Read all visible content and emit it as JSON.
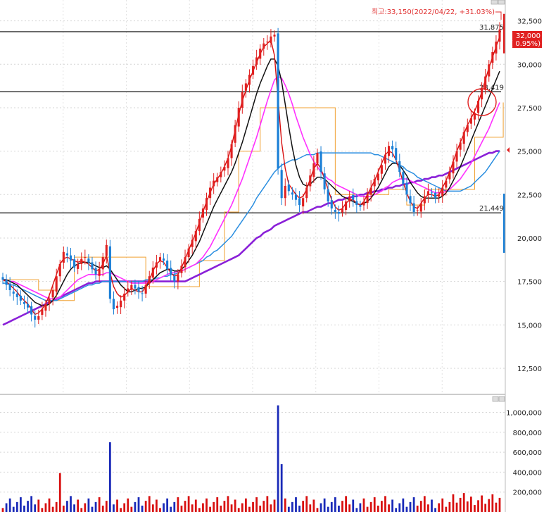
{
  "chart_data": [
    {
      "type": "candlestick",
      "high_label": "최고:33,150(2022/04/22, +31.03%)",
      "last_price_label": "32,000",
      "last_change_label": "( 0.95%)",
      "y_ticks": [
        "32,500",
        "30,000",
        "27,500",
        "25,000",
        "22,500",
        "20,000",
        "17,500",
        "15,000",
        "12,500"
      ],
      "y_tick_values": [
        32500,
        30000,
        27500,
        25000,
        22500,
        20000,
        17500,
        15000,
        12500
      ],
      "ylim": [
        11000,
        33700
      ],
      "grid": true,
      "horizontal_levels": [
        {
          "value": 31875,
          "label": "31,875"
        },
        {
          "value": 28419,
          "label": "28,419"
        },
        {
          "value": 21449,
          "label": "21,449"
        }
      ],
      "volume_profile": [
        {
          "price": 32500,
          "length": 0.1,
          "color": "#e02020"
        },
        {
          "price": 24500,
          "length": 0.15,
          "color": "#1a7fd6"
        }
      ],
      "colors": {
        "up": "#e02020",
        "down": "#1a7fd6",
        "ma5": "#d81010",
        "ma10": "#111111",
        "ma20": "#ff30ff",
        "ma60": "#2a8ee0",
        "ma120": "#8a20d8",
        "envelope": "#f0a030"
      },
      "close": [
        17600,
        17300,
        17000,
        16800,
        16600,
        16400,
        16200,
        16000,
        15600,
        15300,
        15500,
        15900,
        16200,
        16500,
        17000,
        17800,
        18500,
        19200,
        19000,
        18700,
        18300,
        18500,
        18800,
        18900,
        18600,
        18200,
        17900,
        18200,
        18900,
        19600,
        16500,
        15900,
        16100,
        16400,
        16800,
        17100,
        17300,
        17100,
        16900,
        16800,
        17300,
        17800,
        18300,
        18600,
        18900,
        18700,
        18200,
        17900,
        17500,
        17900,
        18400,
        18900,
        19400,
        19900,
        20400,
        21100,
        21700,
        22300,
        22900,
        23300,
        23500,
        23800,
        24100,
        24600,
        25400,
        26500,
        27500,
        28400,
        28900,
        29400,
        29900,
        30400,
        30900,
        31200,
        31300,
        31600,
        31700,
        24000,
        22300,
        23000,
        22700,
        22500,
        22200,
        21900,
        22300,
        22900,
        23600,
        24300,
        24900,
        23800,
        22800,
        22100,
        21700,
        21500,
        21400,
        21700,
        22100,
        22400,
        22200,
        21900,
        21800,
        22100,
        22500,
        22900,
        23400,
        23700,
        24200,
        24800,
        25300,
        25100,
        24500,
        23800,
        23100,
        22500,
        22000,
        21500,
        21600,
        22000,
        22400,
        22700,
        22600,
        22300,
        22500,
        22900,
        23300,
        23800,
        24400,
        25000,
        25500,
        26100,
        26500,
        26900,
        27200,
        27900,
        28600,
        29300,
        30000,
        30700,
        31300,
        32000
      ],
      "ma": {
        "ma5": [
          17600,
          17500,
          17300,
          17100,
          16900,
          16600,
          16400,
          16200,
          15900,
          15600,
          15700,
          15900,
          16200,
          16700,
          17300,
          17900,
          18500,
          18800,
          18900,
          18800,
          18700,
          18600,
          18700,
          18600,
          18500,
          18300,
          18100,
          18200,
          18500,
          19000,
          18000,
          17200,
          16800,
          16600,
          16700,
          16900,
          17100,
          17000,
          16900,
          16900,
          17200,
          17600,
          18100,
          18500,
          18700,
          18600,
          18300,
          18000,
          17800,
          17900,
          18300,
          18800,
          19300,
          19800,
          20300,
          20900,
          21500,
          22100,
          22600,
          23100,
          23400,
          23700,
          24100,
          24600,
          25300,
          26200,
          27100,
          27900,
          28500,
          29100,
          29600,
          30100,
          30600,
          31000,
          31200,
          31400,
          30500,
          28000,
          25500,
          24000,
          23100,
          22800,
          22500,
          22300,
          22400,
          22800,
          23400,
          24000,
          24300,
          24000,
          23400,
          22800,
          22200,
          21800,
          21600,
          21700,
          22000,
          22200,
          22200,
          22000,
          21900,
          22100,
          22500,
          22900,
          23300,
          23800,
          24300,
          24800,
          25000,
          24900,
          24500,
          23900,
          23200,
          22600,
          22100,
          21800,
          21700,
          22000,
          22300,
          22500,
          22500,
          22400,
          22500,
          22900,
          23300,
          23800,
          24400,
          25000,
          25500,
          26000,
          26500,
          26900,
          27300,
          27800,
          28400,
          29100,
          29800,
          30400,
          31000,
          31600
        ],
        "ma10": [
          17600,
          17600,
          17500,
          17400,
          17300,
          17100,
          16900,
          16700,
          16500,
          16300,
          16200,
          16100,
          16100,
          16200,
          16400,
          16700,
          17100,
          17500,
          17900,
          18200,
          18400,
          18500,
          18600,
          18600,
          18600,
          18500,
          18400,
          18300,
          18300,
          18400,
          18200,
          17900,
          17600,
          17300,
          17100,
          16900,
          16900,
          17000,
          17100,
          17100,
          17200,
          17400,
          17600,
          17800,
          18000,
          18100,
          18200,
          18200,
          18100,
          18100,
          18200,
          18400,
          18700,
          19000,
          19400,
          19800,
          20300,
          20800,
          21300,
          21800,
          22200,
          22600,
          23000,
          23400,
          23800,
          24300,
          24900,
          25500,
          26200,
          26900,
          27600,
          28300,
          28900,
          29400,
          29900,
          30300,
          30300,
          29900,
          29000,
          27700,
          26400,
          25200,
          24200,
          23500,
          23100,
          23000,
          23100,
          23300,
          23500,
          23500,
          23400,
          23200,
          23000,
          22800,
          22600,
          22400,
          22300,
          22200,
          22100,
          22000,
          21900,
          22000,
          22100,
          22300,
          22600,
          22900,
          23300,
          23700,
          24100,
          24300,
          24300,
          24200,
          23900,
          23600,
          23200,
          22900,
          22600,
          22400,
          22300,
          22300,
          22300,
          22300,
          22300,
          22400,
          22600,
          22900,
          23300,
          23700,
          24100,
          24600,
          25100,
          25600,
          26100,
          26600,
          27100,
          27600,
          28100,
          28600,
          29100,
          29600
        ],
        "ma20": [
          17600,
          17600,
          17500,
          17500,
          17400,
          17300,
          17200,
          17100,
          17000,
          16900,
          16800,
          16700,
          16600,
          16500,
          16500,
          16500,
          16600,
          16800,
          17000,
          17200,
          17400,
          17600,
          17700,
          17800,
          17900,
          17900,
          17900,
          17900,
          17900,
          18000,
          18000,
          17900,
          17800,
          17700,
          17600,
          17500,
          17400,
          17400,
          17400,
          17400,
          17400,
          17400,
          17500,
          17600,
          17700,
          17800,
          17900,
          18000,
          18000,
          18100,
          18100,
          18200,
          18300,
          18400,
          18500,
          18700,
          18900,
          19200,
          19500,
          19900,
          20300,
          20700,
          21100,
          21500,
          21900,
          22400,
          22900,
          23400,
          24000,
          24600,
          25200,
          25800,
          26500,
          27200,
          27900,
          28500,
          29100,
          29300,
          29200,
          28800,
          28300,
          27700,
          27000,
          26400,
          25800,
          25300,
          24800,
          24400,
          24100,
          23800,
          23600,
          23400,
          23300,
          23100,
          23000,
          22900,
          22800,
          22700,
          22600,
          22500,
          22400,
          22400,
          22400,
          22400,
          22500,
          22600,
          22700,
          22900,
          23000,
          23200,
          23300,
          23400,
          23400,
          23400,
          23300,
          23200,
          23100,
          23000,
          22900,
          22800,
          22700,
          22600,
          22600,
          22600,
          22700,
          22800,
          23000,
          23200,
          23400,
          23700,
          24000,
          24300,
          24700,
          25100,
          25500,
          25900,
          26300,
          26800,
          27300,
          27800
        ],
        "ma60": [
          17400,
          17400,
          17300,
          17300,
          17200,
          17100,
          17000,
          16900,
          16800,
          16700,
          16600,
          16500,
          16400,
          16400,
          16400,
          16400,
          16500,
          16600,
          16700,
          16800,
          16900,
          17000,
          17100,
          17200,
          17300,
          17300,
          17400,
          17400,
          17500,
          17500,
          17500,
          17500,
          17500,
          17500,
          17500,
          17500,
          17500,
          17500,
          17500,
          17500,
          17600,
          17600,
          17600,
          17700,
          17700,
          17800,
          17800,
          17900,
          17900,
          18000,
          18100,
          18200,
          18300,
          18400,
          18500,
          18600,
          18700,
          18900,
          19000,
          19200,
          19300,
          19500,
          19700,
          19900,
          20100,
          20400,
          20700,
          21000,
          21300,
          21600,
          21900,
          22300,
          22600,
          22900,
          23200,
          23500,
          23800,
          24000,
          24200,
          24300,
          24400,
          24500,
          24500,
          24600,
          24700,
          24800,
          24800,
          24800,
          24900,
          24900,
          24900,
          24900,
          24900,
          24900,
          24900,
          24900,
          24900,
          24900,
          24900,
          24900,
          24900,
          24900,
          24900,
          24900,
          24800,
          24800,
          24700,
          24600,
          24500,
          24400,
          24300,
          24200,
          24100,
          23900,
          23800,
          23700,
          23500,
          23400,
          23300,
          23200,
          23100,
          23000,
          22900,
          22800,
          22700,
          22700,
          22700,
          22700,
          22700,
          22800,
          22900,
          23000,
          23200,
          23400,
          23600,
          23800,
          24100,
          24400,
          24700,
          25000
        ],
        "ma120": [
          15000,
          15100,
          15200,
          15300,
          15400,
          15500,
          15600,
          15700,
          15800,
          15900,
          16000,
          16100,
          16200,
          16300,
          16400,
          16500,
          16600,
          16700,
          16800,
          16900,
          17000,
          17100,
          17200,
          17300,
          17400,
          17400,
          17500,
          17500,
          17500,
          17500,
          17500,
          17500,
          17500,
          17500,
          17500,
          17500,
          17500,
          17500,
          17500,
          17500,
          17500,
          17500,
          17500,
          17500,
          17500,
          17500,
          17500,
          17500,
          17500,
          17500,
          17500,
          17500,
          17600,
          17700,
          17800,
          17900,
          18000,
          18100,
          18200,
          18300,
          18400,
          18500,
          18600,
          18700,
          18800,
          18900,
          19000,
          19200,
          19400,
          19600,
          19800,
          20000,
          20100,
          20300,
          20400,
          20500,
          20700,
          20800,
          20900,
          21000,
          21100,
          21200,
          21300,
          21400,
          21500,
          21500,
          21600,
          21700,
          21800,
          21800,
          21900,
          22000,
          22000,
          22100,
          22200,
          22200,
          22300,
          22300,
          22400,
          22400,
          22500,
          22500,
          22600,
          22600,
          22700,
          22700,
          22800,
          22800,
          22900,
          22900,
          23000,
          23000,
          23100,
          23100,
          23200,
          23200,
          23300,
          23300,
          23400,
          23400,
          23500,
          23500,
          23600,
          23600,
          23700,
          23800,
          23900,
          24000,
          24100,
          24200,
          24300,
          24400,
          24500,
          24600,
          24700,
          24800,
          24900,
          24900,
          25000,
          25000
        ]
      },
      "envelope_steps": [
        [
          0,
          17600
        ],
        [
          10,
          17000
        ],
        [
          15,
          16400
        ],
        [
          20,
          18900
        ],
        [
          30,
          18900
        ],
        [
          40,
          17200
        ],
        [
          55,
          18700
        ],
        [
          62,
          21500
        ],
        [
          66,
          25000
        ],
        [
          72,
          27500
        ],
        [
          77,
          27500
        ],
        [
          84,
          27500
        ],
        [
          88,
          27500
        ],
        [
          93,
          22500
        ],
        [
          100,
          22500
        ],
        [
          108,
          22800
        ],
        [
          113,
          21900
        ],
        [
          118,
          22800
        ],
        [
          125,
          22800
        ],
        [
          132,
          25800
        ],
        [
          140,
          27800
        ]
      ]
    },
    {
      "type": "bar",
      "y_ticks": [
        "1,000,000",
        "800,000",
        "600,000",
        "400,000",
        "200,000"
      ],
      "y_tick_values": [
        1000000,
        800000,
        600000,
        400000,
        200000
      ],
      "ylim": [
        0,
        1180000
      ],
      "colors": {
        "up": "#d81010",
        "down": "#1a2ab8"
      },
      "spikes": [
        {
          "index": 16,
          "value": 390000
        },
        {
          "index": 30,
          "value": 700000
        },
        {
          "index": 77,
          "value": 1070000
        },
        {
          "index": 78,
          "value": 480000
        }
      ]
    }
  ]
}
